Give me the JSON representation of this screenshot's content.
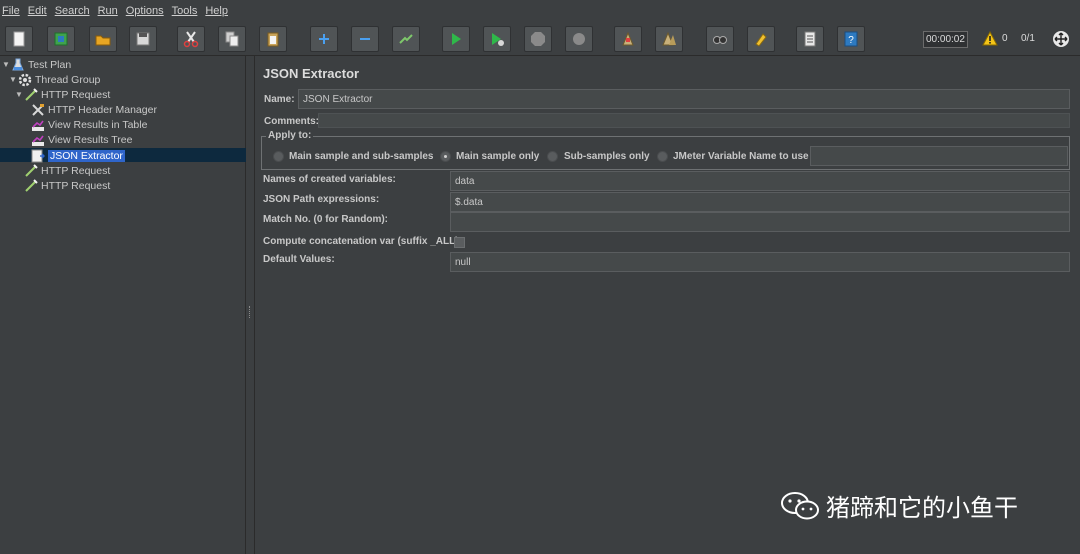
{
  "menu": [
    "File",
    "Edit",
    "Search",
    "Run",
    "Options",
    "Tools",
    "Help"
  ],
  "toolbar": {
    "buttons": [
      "new-icon",
      "templates-icon",
      "open-icon",
      "save-icon",
      "cut-icon",
      "copy-icon",
      "paste-icon",
      "expand-icon",
      "collapse-icon",
      "toggle-icon",
      "start-icon",
      "start-no-pause-icon",
      "stop-icon",
      "shutdown-icon",
      "clear-icon",
      "clear-all-icon",
      "search-icon",
      "reset-search-icon",
      "function-helper-icon",
      "help-icon"
    ],
    "timer": "00:00:02",
    "warning_count": "0",
    "thread_count": "0/1"
  },
  "tree": {
    "items": [
      {
        "label": "Test Plan",
        "icon": "test-plan-icon"
      },
      {
        "label": "Thread Group",
        "icon": "thread-group-icon"
      },
      {
        "label": "HTTP Request",
        "icon": "sampler-icon"
      },
      {
        "label": "HTTP Header Manager",
        "icon": "config-icon"
      },
      {
        "label": "View Results in Table",
        "icon": "listener-icon"
      },
      {
        "label": "View Results Tree",
        "icon": "listener-icon"
      },
      {
        "label": "JSON Extractor",
        "icon": "extractor-icon"
      },
      {
        "label": "HTTP Request",
        "icon": "sampler-icon"
      },
      {
        "label": "HTTP Request",
        "icon": "sampler-icon"
      }
    ]
  },
  "panel": {
    "title": "JSON Extractor",
    "name_label": "Name:",
    "name_value": "JSON Extractor",
    "comments_label": "Comments:",
    "apply_to_label": "Apply to:",
    "apply_options": [
      "Main sample and sub-samples",
      "Main sample only",
      "Sub-samples only",
      "JMeter Variable Name to use"
    ],
    "apply_selected": "Main sample only",
    "var_names_label": "Names of created variables:",
    "var_names_value": "data",
    "json_path_label": "JSON Path expressions:",
    "json_path_value": "$.data",
    "match_no_label": "Match No. (0 for Random):",
    "match_no_value": "",
    "concat_label": "Compute concatenation var (suffix _ALL):",
    "default_label": "Default Values:",
    "default_value": "null"
  },
  "watermark": {
    "text": "猪蹄和它的小鱼干"
  },
  "colors": {
    "background": "#3c3f41",
    "selection": "#2f65ca",
    "field": "#45494a"
  }
}
